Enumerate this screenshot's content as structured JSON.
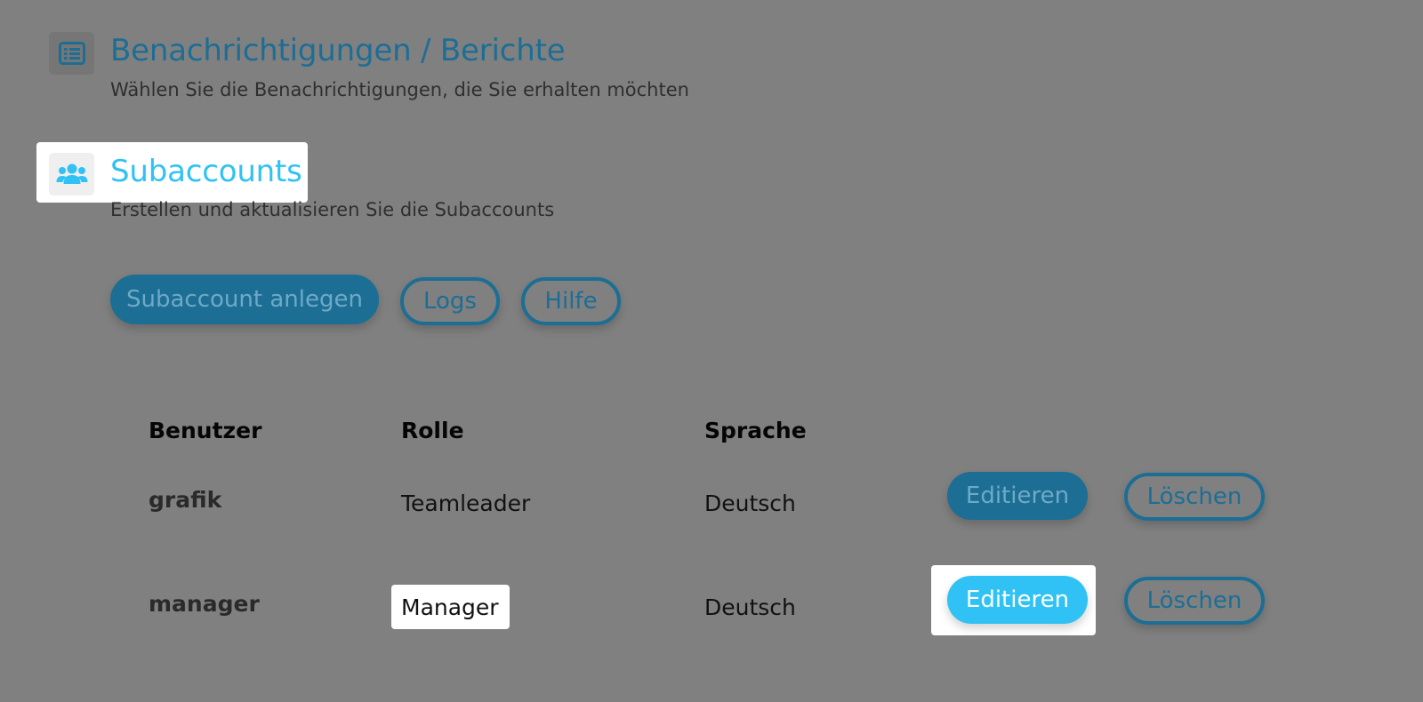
{
  "notifications": {
    "title": "Benachrichtigungen / Berichte",
    "subtitle": "Wählen Sie die Benachrichtigungen, die Sie erhalten möchten",
    "icon": "list-icon"
  },
  "subaccounts": {
    "title": "Subaccounts",
    "subtitle": "Erstellen und aktualisieren Sie die Subaccounts",
    "icon": "users-icon",
    "accent_color": "#30c2f4"
  },
  "actions": {
    "create_label": "Subaccount anlegen",
    "logs_label": "Logs",
    "help_label": "Hilfe"
  },
  "table": {
    "headers": {
      "user": "Benutzer",
      "role": "Rolle",
      "language": "Sprache"
    },
    "rows": [
      {
        "user": "grafik",
        "role": "Teamleader",
        "language": "Deutsch",
        "edit_label": "Editieren",
        "delete_label": "Löschen"
      },
      {
        "user": "manager",
        "role": "Manager",
        "language": "Deutsch",
        "edit_label": "Editieren",
        "delete_label": "Löschen"
      }
    ]
  },
  "colors": {
    "overlay": "#808080",
    "primary": "#1c6e95",
    "highlight": "#30c2f4"
  }
}
